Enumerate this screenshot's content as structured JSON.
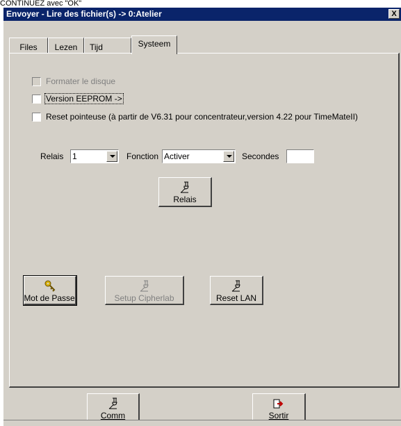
{
  "caption": "CONTINUEZ avec \"OK\"",
  "window": {
    "title": "Envoyer - Lire des fichier(s) -> 0:Atelier",
    "close_label": "X"
  },
  "tabs": [
    {
      "label": "Files"
    },
    {
      "label": "Lezen"
    },
    {
      "label": "Tijd"
    },
    {
      "label": "Systeem",
      "active": true
    }
  ],
  "checkboxes": {
    "format": {
      "label": "Formater le disque",
      "checked": false,
      "enabled": false
    },
    "eeprom": {
      "label": "Version EEPROM ->",
      "checked": false,
      "enabled": true
    },
    "reset": {
      "label": "Reset pointeuse (à partir de V6.31 pour concentrateur,version 4.22 pour TimeMateII)",
      "checked": false,
      "enabled": true
    }
  },
  "relais_row": {
    "relais_label": "Relais",
    "relais_value": "1",
    "fonction_label": "Fonction",
    "fonction_value": "Activer",
    "secondes_label": "Secondes",
    "secondes_value": ""
  },
  "buttons": {
    "relais": {
      "label": "Relais",
      "icon": "plug-icon"
    },
    "password": {
      "label": "Mot de Passe",
      "icon": "key-icon"
    },
    "cipherlab": {
      "label": "Setup Cipherlab",
      "icon": "plug-icon",
      "enabled": false
    },
    "reset_lan": {
      "label": "Reset LAN",
      "icon": "plug-icon"
    },
    "comm": {
      "label": "Comm",
      "icon": "plug-icon"
    },
    "sortir": {
      "label": "Sortir",
      "icon": "exit-icon"
    }
  },
  "colors": {
    "titlebar": "#0a246a",
    "face": "#d4d0c8",
    "exit_arrow": "#c00000",
    "key": "#d8b000"
  }
}
